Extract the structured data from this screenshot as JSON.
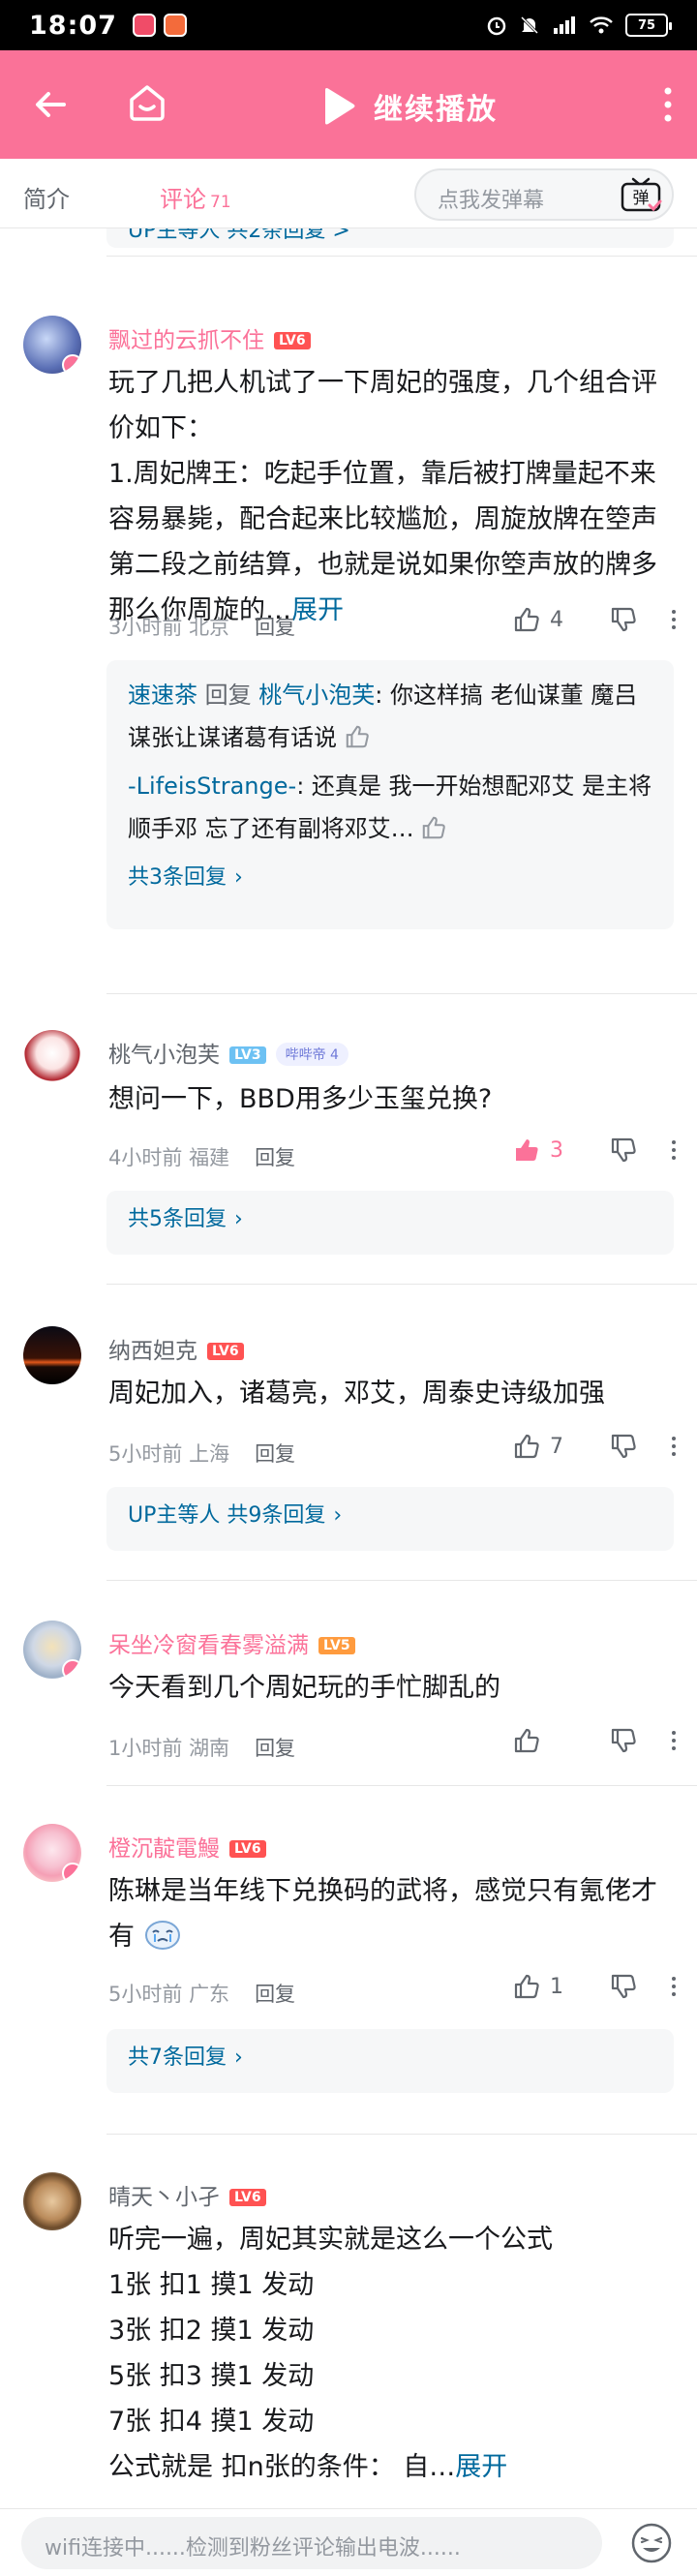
{
  "status_bar": {
    "time": "18:07",
    "battery": "75"
  },
  "topbar": {
    "play_label": "继续播放"
  },
  "tabs": {
    "intro": "简介",
    "comments": "评论",
    "comments_count": "71"
  },
  "danmu": {
    "placeholder": "点我发弹幕",
    "button": "弹"
  },
  "cut_reply": "UP主等人 共2条回复 >",
  "comments": [
    {
      "user": "飘过的云抓不住",
      "level": "LV6",
      "vip": true,
      "text": "玩了几把人机试了一下周妃的强度，几个组合评价如下：\n1.周妃牌王：吃起手位置，靠后被打牌量起不来容易暴毙，配合起来比较尴尬，周旋放牌在箜声第二段之前结算，也就是说如果你箜声放的牌多那么你周旋的…",
      "expand": "展开",
      "time": "3小时前",
      "location": "北京",
      "reply": "回复",
      "likes": "4",
      "sub": [
        {
          "name": "速速茶",
          "reply": "回复",
          "to": "桃气小泡芙",
          "text": ": 你这样搞 老仙谋董 魔吕谋张让谋诸葛有话说"
        },
        {
          "name": "-LifeisStrange-",
          "reply": "",
          "to": "",
          "text": ": 还真是 我一开始想配邓艾 是主将顺手邓 忘了还有副将邓艾…"
        }
      ],
      "total": "共3条回复"
    },
    {
      "user": "桃气小泡芙",
      "level": "LV3",
      "vip": false,
      "fan_badge": "哔哔帝 4",
      "text": "想问一下，BBD用多少玉玺兑换?",
      "time": "4小时前",
      "location": "福建",
      "reply": "回复",
      "likes": "3",
      "total": "共5条回复"
    },
    {
      "user": "纳西妲克",
      "level": "LV6",
      "vip": false,
      "text": "周妃加入，诸葛亮，邓艾，周泰史诗级加强",
      "time": "5小时前",
      "location": "上海",
      "reply": "回复",
      "likes": "7",
      "total": "UP主等人 共9条回复"
    },
    {
      "user": "呆坐冷窗看春雾溢满",
      "level": "LV5",
      "vip": true,
      "text": "今天看到几个周妃玩的手忙脚乱的",
      "time": "1小时前",
      "location": "湖南",
      "reply": "回复",
      "likes": ""
    },
    {
      "user": "橙沉靛電鰻",
      "level": "LV6",
      "vip": true,
      "text": "陈琳是当年线下兑换码的武将，感觉只有氪佬才有",
      "time": "5小时前",
      "location": "广东",
      "reply": "回复",
      "likes": "1",
      "total": "共7条回复"
    },
    {
      "user": "晴天丶小孑",
      "level": "LV6",
      "vip": false,
      "text": "听完一遍，周妃其实就是这么一个公式\n1张 扣1 摸1 发动\n3张 扣2 摸1 发动\n5张 扣3 摸1 发动\n7张 扣4 摸1 发动\n公式就是 扣n张的条件： 自…",
      "expand": "展开"
    }
  ],
  "bottom": {
    "placeholder": "wifi连接中......检测到粉丝评论输出电波......"
  },
  "colors": {
    "accent": "#fb7299",
    "topbar": "#fa7298",
    "link": "#00699d",
    "lv6": "#ff5252",
    "lv5": "#ff9b3e",
    "lv3": "#6dc1f3"
  }
}
